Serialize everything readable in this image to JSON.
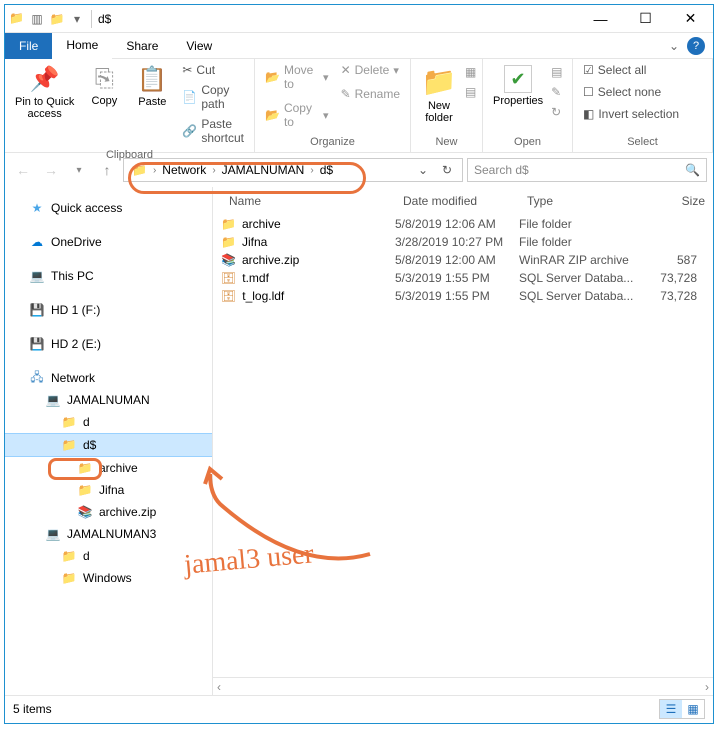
{
  "window": {
    "title": "d$"
  },
  "menu": {
    "file": "File",
    "home": "Home",
    "share": "Share",
    "view": "View"
  },
  "ribbon": {
    "clipboard": {
      "label": "Clipboard",
      "pin": "Pin to Quick\naccess",
      "copy": "Copy",
      "paste": "Paste",
      "cut": "Cut",
      "copypath": "Copy path",
      "pasteshortcut": "Paste shortcut"
    },
    "organize": {
      "label": "Organize",
      "moveto": "Move to",
      "copyto": "Copy to",
      "delete": "Delete",
      "rename": "Rename"
    },
    "new": {
      "label": "New",
      "newfolder": "New\nfolder"
    },
    "open": {
      "label": "Open",
      "properties": "Properties"
    },
    "select": {
      "label": "Select",
      "selectall": "Select all",
      "selectnone": "Select none",
      "invert": "Invert selection"
    }
  },
  "breadcrumbs": [
    "Network",
    "JAMALNUMAN",
    "d$"
  ],
  "search": {
    "placeholder": "Search d$"
  },
  "nav": {
    "quick": "Quick access",
    "onedrive": "OneDrive",
    "thispc": "This PC",
    "hd1": "HD 1 (F:)",
    "hd2": "HD 2 (E:)",
    "network": "Network",
    "jn1": "JAMALNUMAN",
    "d": "d",
    "ds": "d$",
    "archive": "archive",
    "jifna": "Jifna",
    "archivezip": "archive.zip",
    "jn3": "JAMALNUMAN3",
    "d2": "d",
    "windows": "Windows"
  },
  "columns": {
    "name": "Name",
    "date": "Date modified",
    "type": "Type",
    "size": "Size"
  },
  "files": [
    {
      "name": "archive",
      "date": "5/8/2019 12:06 AM",
      "type": "File folder",
      "size": "",
      "icon": "folder"
    },
    {
      "name": "Jifna",
      "date": "3/28/2019 10:27 PM",
      "type": "File folder",
      "size": "",
      "icon": "folder"
    },
    {
      "name": "archive.zip",
      "date": "5/8/2019 12:00 AM",
      "type": "WinRAR ZIP archive",
      "size": "587",
      "icon": "zip"
    },
    {
      "name": "t.mdf",
      "date": "5/3/2019 1:55 PM",
      "type": "SQL Server Databa...",
      "size": "73,728",
      "icon": "db"
    },
    {
      "name": "t_log.ldf",
      "date": "5/3/2019 1:55 PM",
      "type": "SQL Server Databa...",
      "size": "73,728",
      "icon": "db"
    }
  ],
  "status": {
    "items": "5 items"
  },
  "annotation": {
    "text": "jamal3 user"
  }
}
